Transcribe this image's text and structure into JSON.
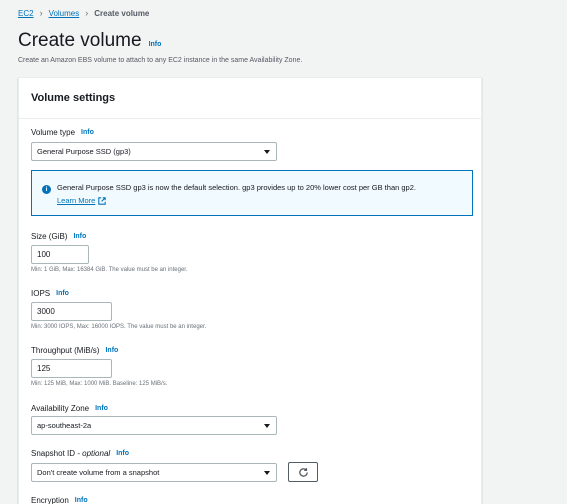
{
  "breadcrumb": {
    "items": [
      "EC2",
      "Volumes"
    ],
    "current": "Create volume"
  },
  "header": {
    "title": "Create volume",
    "info": "Info",
    "subtitle": "Create an Amazon EBS volume to attach to any EC2 instance in the same Availability Zone."
  },
  "panel": {
    "title": "Volume settings"
  },
  "volume_type": {
    "label": "Volume type",
    "info": "Info",
    "value": "General Purpose SSD (gp3)"
  },
  "alert": {
    "icon": "info-circle-icon",
    "message": "General Purpose SSD gp3 is now the default selection. gp3 provides up to 20% lower cost per GB than gp2.",
    "link": "Learn More"
  },
  "size": {
    "label": "Size (GiB)",
    "info": "Info",
    "value": "100",
    "hint": "Min: 1 GiB, Max: 16384 GiB. The value must be an integer."
  },
  "iops": {
    "label": "IOPS",
    "info": "Info",
    "value": "3000",
    "hint": "Min: 3000 IOPS, Max: 16000 IOPS. The value must be an integer."
  },
  "throughput": {
    "label": "Throughput (MiB/s)",
    "info": "Info",
    "value": "125",
    "hint": "Min: 125 MiB, Max: 1000 MiB. Baseline: 125 MiB/s."
  },
  "availability_zone": {
    "label": "Availability Zone",
    "info": "Info",
    "value": "ap-southeast-2a"
  },
  "snapshot": {
    "label": "Snapshot ID",
    "optional": "- optional",
    "info": "Info",
    "value": "Don't create volume from a snapshot",
    "refresh_icon": "refresh-icon"
  },
  "encryption": {
    "label": "Encryption",
    "info": "Info"
  },
  "colors": {
    "link": "#0073bb",
    "background": "#f2f3f3",
    "alert_bg": "#f1faff"
  }
}
